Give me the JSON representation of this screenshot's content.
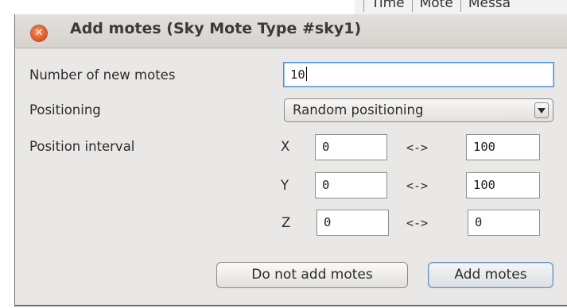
{
  "background_window": {
    "menu_items": [
      "Time",
      "Mote",
      "Messa"
    ]
  },
  "dialog": {
    "title": "Add motes (Sky Mote Type #sky1)",
    "close_icon": "close-icon",
    "number_label": "Number of new motes",
    "number_value": "10",
    "positioning_label": "Positioning",
    "positioning_value": "Random positioning",
    "interval_label": "Position interval",
    "range_separator": "<->",
    "axes": {
      "x": {
        "label": "X",
        "min": "0",
        "max": "100"
      },
      "y": {
        "label": "Y",
        "min": "0",
        "max": "100"
      },
      "z": {
        "label": "Z",
        "min": "0",
        "max": "0"
      }
    },
    "cancel_label": "Do not add motes",
    "confirm_label": "Add motes"
  },
  "colors": {
    "dialog_bg": "#eae8e6",
    "close_button": "#e0592e",
    "focus_border": "#4a90d9"
  }
}
